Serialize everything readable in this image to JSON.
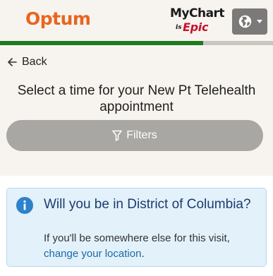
{
  "header": {
    "brand_name": "Optum",
    "brand_color": "#e8651f",
    "mychart_top": "MyChart",
    "mychart_by": "is",
    "mychart_epic": "Epic",
    "epic_color": "#c8102e",
    "language_icon": "globe-icon",
    "language_caret_icon": "caret-down-icon"
  },
  "progress": {
    "value": 0.745,
    "fill_color": "#1f7a1f"
  },
  "nav": {
    "back_label": "Back",
    "back_icon": "arrow-left-icon"
  },
  "page": {
    "title": "Select a time for your New Pt Telehealth appointment"
  },
  "filters": {
    "label": "Filters",
    "icon": "funnel-icon",
    "bg_color": "#a9a7a4"
  },
  "location_notice": {
    "icon": "info-icon",
    "icon_color": "#2d82c9",
    "title": "Will you be in District of Columbia?",
    "body_prefix": "If you'll be somewhere else for this visit, ",
    "link_text": "change your location",
    "body_suffix": "."
  }
}
